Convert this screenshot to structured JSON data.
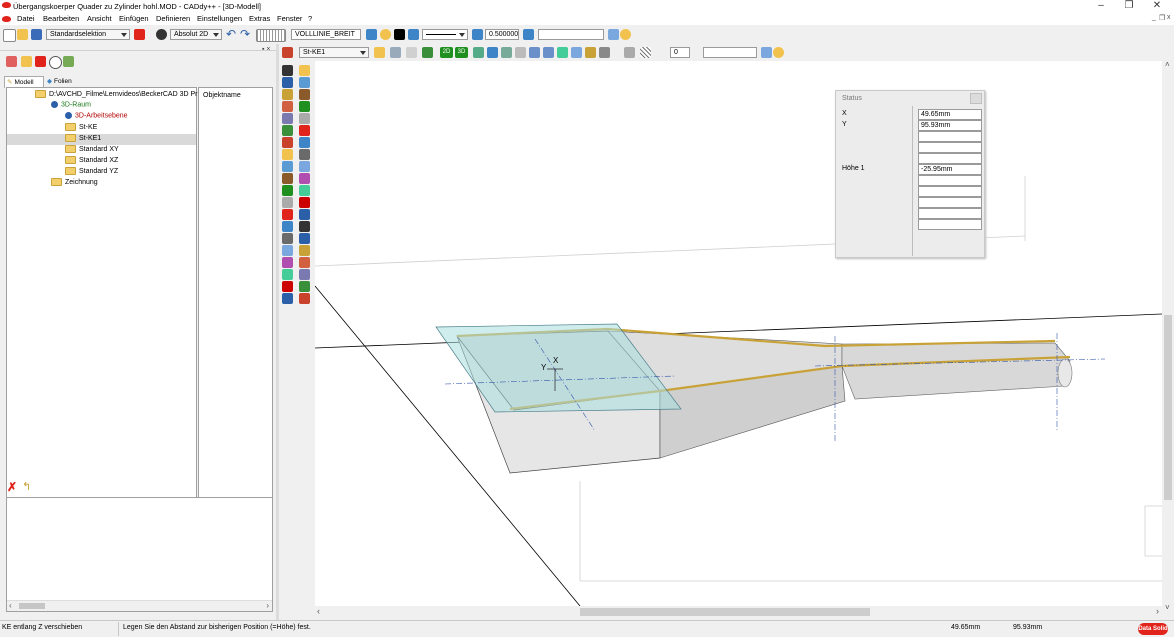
{
  "window": {
    "title": "Übergangskoerper Quader zu Zylinder hohl.MOD  -  CADdy++ - [3D-Modell]",
    "minimize": "–",
    "restore": "❐",
    "close": "✕",
    "inner_min": "_",
    "inner_restore": "❐",
    "inner_close": "x"
  },
  "menu": [
    "Datei",
    "Bearbeiten",
    "Ansicht",
    "Einfügen",
    "Definieren",
    "Einstellungen",
    "Extras",
    "Fenster",
    "?"
  ],
  "toolbar1": {
    "selection_mode": "Standardselektion",
    "coord_mode": "Absolut 2D",
    "linetype_name": "VOLLLINIE_BREIT",
    "line_width": "0.500000",
    "extra_field": ""
  },
  "toolbar2": {
    "layer_name": "St-KE1",
    "btn_2d": "2D",
    "btn_3d": "3D",
    "spin_value": "0",
    "extra_field": ""
  },
  "panel": {
    "pin": "▪ ×",
    "tabs": [
      "Modell",
      "Folien"
    ],
    "tree": [
      {
        "label": "D:\\AVCHD_Filme\\Lernvideos\\BeckerCAD 3D Pr",
        "level": 0,
        "kind": "file",
        "color": "#000000"
      },
      {
        "label": "3D-Raum",
        "level": 1,
        "kind": "globe",
        "color": "#1a7a1a"
      },
      {
        "label": "3D-Arbeitsebene",
        "level": 2,
        "kind": "globe",
        "color": "#b00000"
      },
      {
        "label": "St-KE",
        "level": 2,
        "kind": "folder",
        "color": "#000000"
      },
      {
        "label": "St-KE1",
        "level": 2,
        "kind": "folder",
        "color": "#000000"
      },
      {
        "label": "Standard XY",
        "level": 2,
        "kind": "folder",
        "color": "#000000"
      },
      {
        "label": "Standard XZ",
        "level": 2,
        "kind": "folder",
        "color": "#000000"
      },
      {
        "label": "Standard YZ",
        "level": 2,
        "kind": "folder",
        "color": "#000000"
      },
      {
        "label": "Zeichnung",
        "level": 1,
        "kind": "folder",
        "color": "#000000"
      }
    ],
    "selected_index": 4,
    "object_header": "Objektname"
  },
  "status_window": {
    "title": "Status",
    "rows": [
      {
        "label": "X",
        "value": "49.65mm"
      },
      {
        "label": "Y",
        "value": "95.93mm"
      },
      {
        "label": "",
        "value": ""
      },
      {
        "label": "",
        "value": ""
      },
      {
        "label": "",
        "value": ""
      },
      {
        "label": "Höhe 1",
        "value": "-25.95mm"
      },
      {
        "label": "",
        "value": ""
      },
      {
        "label": "",
        "value": ""
      },
      {
        "label": "",
        "value": ""
      },
      {
        "label": "",
        "value": ""
      },
      {
        "label": "",
        "value": ""
      }
    ]
  },
  "viewport": {
    "axis_label_y": "Y",
    "axis_label_x": "X",
    "part_edge_color": "#c9a237",
    "plane_color": "#a9dfe0"
  },
  "statusbar": {
    "left": "KE entlang Z verschieben",
    "prompt": "Legen Sie den Abstand zur bisherigen Position (=Höhe) fest.",
    "x": "49.65mm",
    "y": "95.93mm",
    "logo": "Data Solid"
  },
  "colors": {
    "accent_red": "#e0231b",
    "tree_green": "#1a7a1a",
    "tree_red": "#b00000"
  }
}
